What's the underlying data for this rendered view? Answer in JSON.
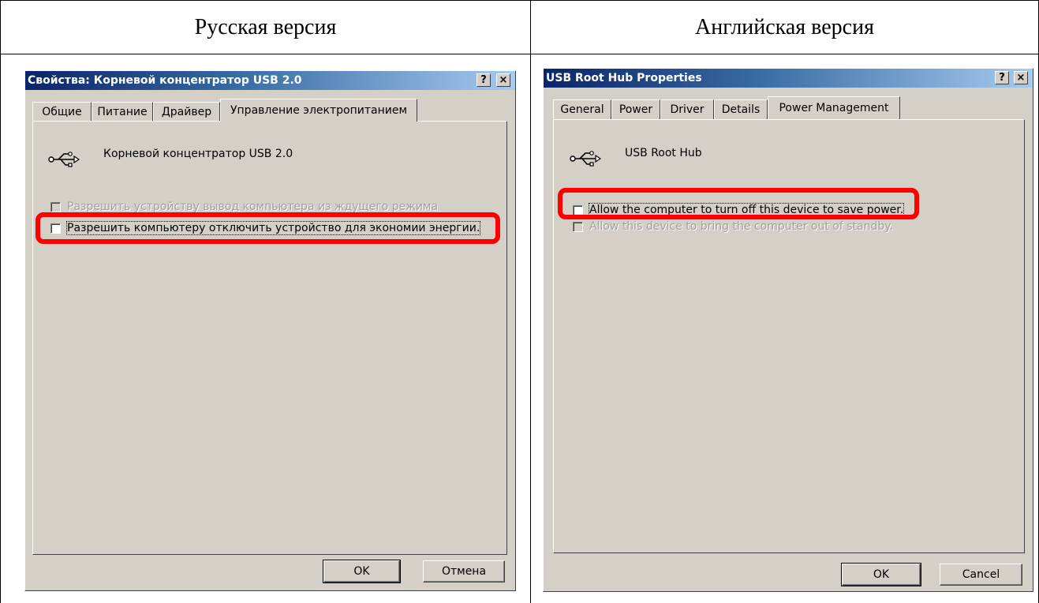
{
  "columns": {
    "left_header": "Русская версия",
    "right_header": "Английская версия"
  },
  "ru_dialog": {
    "title": "Свойства: Корневой концентратор USB 2.0",
    "help_button": "?",
    "close_button": "×",
    "tabs": [
      "Общие",
      "Питание",
      "Драйвер",
      "Управление электропитанием"
    ],
    "active_tab": "Управление электропитанием",
    "device_name": "Корневой концентратор USB 2.0",
    "device_icon": "usb-icon",
    "options": [
      {
        "label": "Разрешить устройству вывод компьютера из ждущего режима",
        "checked": false,
        "enabled": false
      },
      {
        "label": "Разрешить компьютеру отключить устройство для экономии энергии.",
        "checked": false,
        "enabled": true
      }
    ],
    "ok_button": "OK",
    "cancel_button": "Отмена"
  },
  "en_dialog": {
    "title": "USB Root Hub Properties",
    "help_button": "?",
    "close_button": "×",
    "tabs": [
      "General",
      "Power",
      "Driver",
      "Details",
      "Power Management"
    ],
    "active_tab": "Power Management",
    "device_name": "USB Root Hub",
    "device_icon": "usb-icon",
    "options": [
      {
        "label": "Allow the computer to turn off this device to save power.",
        "checked": false,
        "enabled": true
      },
      {
        "label": "Allow this device to bring the computer out of standby.",
        "checked": false,
        "enabled": false
      }
    ],
    "ok_button": "OK",
    "cancel_button": "Cancel"
  },
  "colors": {
    "dialog_face": "#d4d0c8",
    "titlebar_start": "#0a246a",
    "titlebar_end": "#a6caf0",
    "highlight": "#ff0000"
  }
}
